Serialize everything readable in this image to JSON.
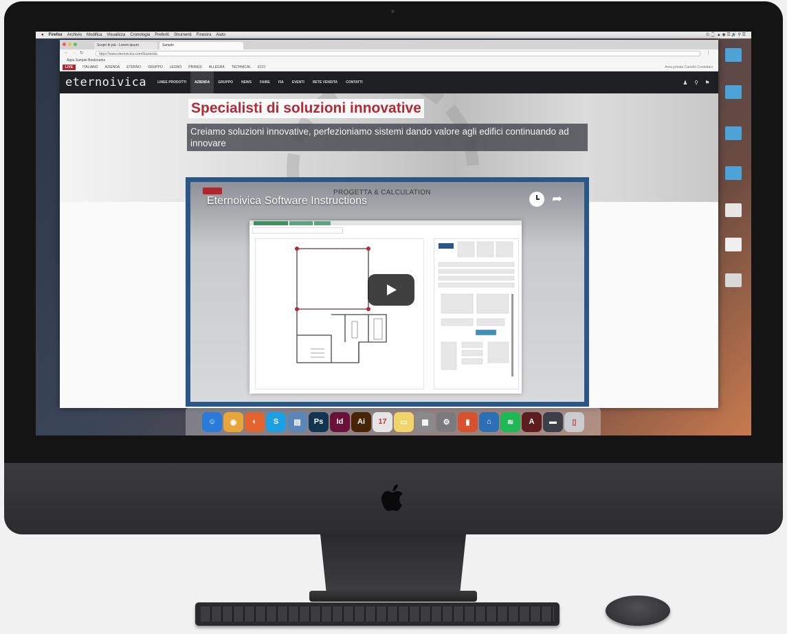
{
  "menubar": {
    "items": [
      "Firefox",
      "Archivio",
      "Modifica",
      "Visualizza",
      "Cronologia",
      "Preferiti",
      "Strumenti",
      "Finestra",
      "Aiuto"
    ],
    "tray": "⏻ ⌚ ▲ ◉ ☰ 🔊 ⚲ ☰"
  },
  "browser": {
    "tab1_label": "Scopri di più - Lorem ipsum",
    "tab2_label": "Sample",
    "url": "https://www.eternoivica.com/it/azienda",
    "bookmarks": "Apps   Sample Bookmarks",
    "topnav": {
      "live_label": "LIVE",
      "items": [
        "ITALIANO",
        "AZIENDA",
        "ETERNO",
        "GRUPPO",
        "LEGNO",
        "PRIMUS",
        "ALLEGRA",
        "TECHNICAL",
        "ECO"
      ],
      "right": "Area privata   Carrello   Contattaci"
    }
  },
  "site": {
    "logo": "eternoivica",
    "nav": [
      "LINEE PRODOTTI",
      "AZIENDA",
      "GRUPPO",
      "NEWS",
      "FAIRE",
      "FIA",
      "EVENTI",
      "RETE VENDITA",
      "CONTATTI"
    ],
    "nav_active_index": 1,
    "hero_title": "Specialisti di soluzioni innovative",
    "hero_subtitle": "Creiamo soluzioni innovative, perfezioniamo sistemi dando valore agli edifici continuando ad innovare"
  },
  "video": {
    "title": "Eternoivica Software Instructions",
    "overlay_label": "PROGETTA & CALCULATION",
    "state": "paused"
  },
  "dock": {
    "apps": [
      {
        "name": "finder-icon",
        "glyph": "☺",
        "color": "#2a7ad9"
      },
      {
        "name": "chrome-icon",
        "glyph": "◉",
        "color": "#e8a53a"
      },
      {
        "name": "firefox-icon",
        "glyph": "◐",
        "color": "#e2632d"
      },
      {
        "name": "skype-icon",
        "glyph": "S",
        "color": "#1ca0e3"
      },
      {
        "name": "preview-icon",
        "glyph": "▤",
        "color": "#5b87b8"
      },
      {
        "name": "photoshop-icon",
        "glyph": "Ps",
        "color": "#0f3550"
      },
      {
        "name": "indesign-icon",
        "glyph": "Id",
        "color": "#6b1038"
      },
      {
        "name": "illustrator-icon",
        "glyph": "Ai",
        "color": "#472406"
      },
      {
        "name": "calendar-icon",
        "glyph": "17",
        "color": "#e5e5e5"
      },
      {
        "name": "notes-icon",
        "glyph": "▭",
        "color": "#f1d56a"
      },
      {
        "name": "file-manager-icon",
        "glyph": "▦",
        "color": "#8a8a8a"
      },
      {
        "name": "system-prefs-icon",
        "glyph": "⚙",
        "color": "#7a7a7d"
      },
      {
        "name": "keynote-icon",
        "glyph": "▮",
        "color": "#d6512e"
      },
      {
        "name": "vpn-icon",
        "glyph": "⌂",
        "color": "#2c6fb3"
      },
      {
        "name": "spotify-icon",
        "glyph": "≋",
        "color": "#1db954"
      },
      {
        "name": "acrobat-icon",
        "glyph": "A",
        "color": "#5b1d1d"
      },
      {
        "name": "downloads-icon",
        "glyph": "▬",
        "color": "#3a3f4a"
      },
      {
        "name": "trash-icon",
        "glyph": "▯",
        "color": "#c8ccd0"
      }
    ]
  }
}
